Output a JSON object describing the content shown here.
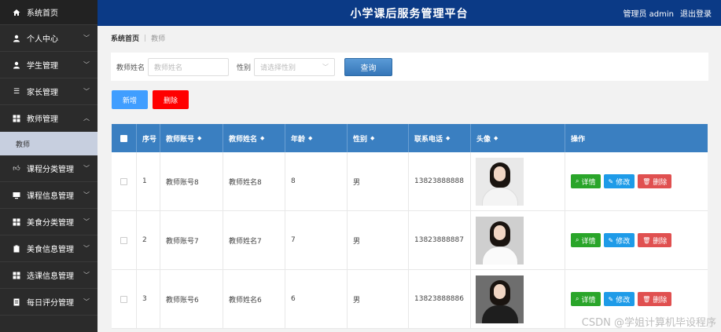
{
  "header": {
    "title": "小学课后服务管理平台",
    "user": "管理员 admin",
    "logout": "退出登录"
  },
  "sidebar": {
    "home": "系统首页",
    "items": [
      {
        "label": "个人中心",
        "icon": "user-icon"
      },
      {
        "label": "学生管理",
        "icon": "user-icon"
      },
      {
        "label": "家长管理",
        "icon": "list-icon"
      },
      {
        "label": "教师管理",
        "icon": "grid-icon",
        "expanded": true
      },
      {
        "label": "课程分类管理",
        "icon": "thumb-icon"
      },
      {
        "label": "课程信息管理",
        "icon": "monitor-icon"
      },
      {
        "label": "美食分类管理",
        "icon": "grid-icon"
      },
      {
        "label": "美食信息管理",
        "icon": "clipboard-icon"
      },
      {
        "label": "选课信息管理",
        "icon": "grid-icon"
      },
      {
        "label": "每日评分管理",
        "icon": "doc-icon"
      }
    ],
    "sub_item": "教师"
  },
  "breadcrumb": {
    "home": "系统首页",
    "current": "教师"
  },
  "search": {
    "name_label": "教师姓名",
    "name_placeholder": "教师姓名",
    "gender_label": "性别",
    "gender_placeholder": "请选择性别",
    "query_button": "查询"
  },
  "actions": {
    "add": "新增",
    "delete": "删除"
  },
  "table": {
    "columns": [
      "序号",
      "教师账号",
      "教师姓名",
      "年龄",
      "性别",
      "联系电话",
      "头像",
      "操作"
    ],
    "rows": [
      {
        "index": "1",
        "account": "教师账号8",
        "name": "教师姓名8",
        "age": "8",
        "gender": "男",
        "phone": "13823888888"
      },
      {
        "index": "2",
        "account": "教师账号7",
        "name": "教师姓名7",
        "age": "7",
        "gender": "男",
        "phone": "13823888887"
      },
      {
        "index": "3",
        "account": "教师账号6",
        "name": "教师姓名6",
        "age": "6",
        "gender": "男",
        "phone": "13823888886"
      }
    ],
    "op_labels": {
      "detail": "详情",
      "edit": "修改",
      "delete": "删除"
    }
  },
  "watermark": "CSDN @学姐计算机毕设程序",
  "colors": {
    "header": "#0b3a86",
    "sidebar": "#2b2b2b",
    "table_head": "#3a7fc1",
    "add": "#409eff",
    "delete": "#ff0000"
  }
}
